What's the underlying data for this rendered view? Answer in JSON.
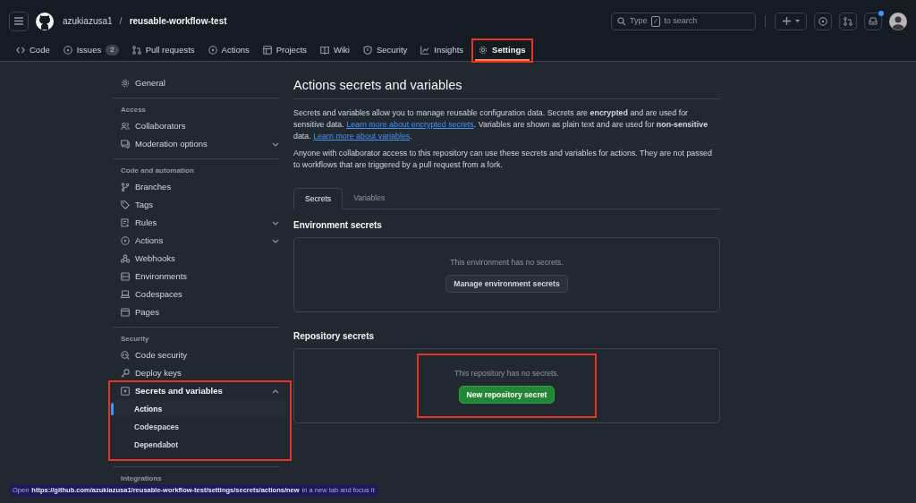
{
  "header": {
    "owner": "azukiazusa1",
    "separator": "/",
    "repo": "reusable-workflow-test",
    "search": {
      "placeholder_before": "Type",
      "key": "/",
      "placeholder_after": "to search"
    },
    "notification_unread": true
  },
  "repo_tabs": [
    {
      "label": "Code",
      "selected": false,
      "highlighted": false
    },
    {
      "label": "Issues",
      "count": "2",
      "selected": false,
      "highlighted": false
    },
    {
      "label": "Pull requests",
      "selected": false,
      "highlighted": false
    },
    {
      "label": "Actions",
      "selected": false,
      "highlighted": false
    },
    {
      "label": "Projects",
      "selected": false,
      "highlighted": false
    },
    {
      "label": "Wiki",
      "selected": false,
      "highlighted": false
    },
    {
      "label": "Security",
      "selected": false,
      "highlighted": false
    },
    {
      "label": "Insights",
      "selected": false,
      "highlighted": false
    },
    {
      "label": "Settings",
      "selected": true,
      "highlighted": true
    }
  ],
  "sidebar": {
    "items": [
      {
        "kind": "item",
        "label": "General",
        "selected": false
      },
      {
        "kind": "heading",
        "label": "Access"
      },
      {
        "kind": "item",
        "label": "Collaborators",
        "selected": false
      },
      {
        "kind": "item",
        "label": "Moderation options",
        "selected": false,
        "expanded": false
      },
      {
        "kind": "heading",
        "label": "Code and automation"
      },
      {
        "kind": "item",
        "label": "Branches",
        "selected": false
      },
      {
        "kind": "item",
        "label": "Tags",
        "selected": false
      },
      {
        "kind": "item",
        "label": "Rules",
        "selected": false,
        "expanded": false
      },
      {
        "kind": "item",
        "label": "Actions",
        "selected": false,
        "expanded": false
      },
      {
        "kind": "item",
        "label": "Webhooks",
        "selected": false
      },
      {
        "kind": "item",
        "label": "Environments",
        "selected": false
      },
      {
        "kind": "item",
        "label": "Codespaces",
        "selected": false
      },
      {
        "kind": "item",
        "label": "Pages",
        "selected": false
      },
      {
        "kind": "heading",
        "label": "Security"
      },
      {
        "kind": "item",
        "label": "Code security",
        "selected": false
      },
      {
        "kind": "item",
        "label": "Deploy keys",
        "selected": false
      },
      {
        "kind": "item",
        "label": "Secrets and variables",
        "selected": false,
        "expanded": true,
        "highlighted": true,
        "children": [
          {
            "label": "Actions",
            "selected": true
          },
          {
            "label": "Codespaces",
            "selected": false
          },
          {
            "label": "Dependabot",
            "selected": false
          }
        ]
      },
      {
        "kind": "heading",
        "label": "Integrations"
      }
    ]
  },
  "content": {
    "title": "Actions secrets and variables",
    "paragraphs": [
      [
        {
          "kind": "text",
          "text": "Secrets and variables allow you to manage reusable configuration data. Secrets are **encrypted** and are used for sensitive data. "
        },
        {
          "kind": "link",
          "text": "Learn more about encrypted secrets"
        },
        {
          "kind": "text",
          "text": ". Variables are shown as plain text and are used for **non-sensitive** data. "
        },
        {
          "kind": "link",
          "text": "Learn more about variables"
        },
        {
          "kind": "text",
          "text": "."
        }
      ],
      [
        {
          "kind": "text",
          "text": "Anyone with collaborator access to this repository can use these secrets and variables for actions. They are not passed to workflows that are triggered by a pull request from a fork."
        }
      ]
    ],
    "tabs": [
      {
        "label": "Secrets",
        "selected": true
      },
      {
        "label": "Variables",
        "selected": false
      }
    ],
    "sections": [
      {
        "heading": "Environment secrets",
        "empty_text": "This environment has no secrets.",
        "button": {
          "label": "Manage environment secrets",
          "kind": "default"
        },
        "highlighted": false
      },
      {
        "heading": "Repository secrets",
        "empty_text": "This repository has no secrets.",
        "button": {
          "label": "New repository secret",
          "kind": "primary"
        },
        "highlighted": true
      }
    ]
  },
  "status_tooltip": {
    "before": "Open",
    "url": "https://github.com/azukiazusa1/reusable-workflow-test/settings/secrets/actions/new",
    "after": "in a new tab and focus it"
  }
}
